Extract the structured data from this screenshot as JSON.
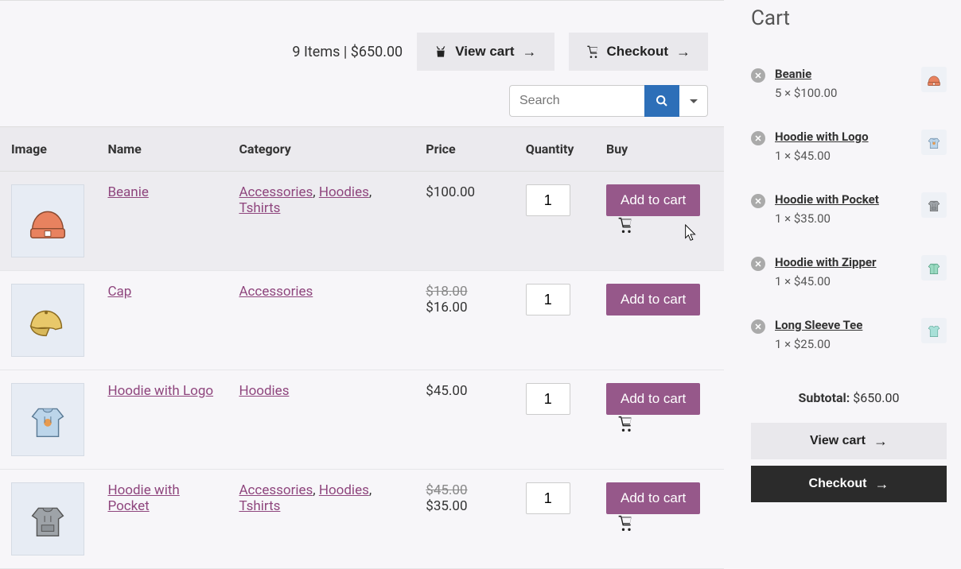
{
  "toolbar": {
    "summary": "9 Items | $650.00",
    "view_cart": "View cart",
    "checkout": "Checkout"
  },
  "search": {
    "placeholder": "Search"
  },
  "columns": {
    "image": "Image",
    "name": "Name",
    "category": "Category",
    "price": "Price",
    "quantity": "Quantity",
    "buy": "Buy"
  },
  "add_to_cart_label": "Add to cart",
  "products": [
    {
      "name": "Beanie",
      "categories": [
        "Accessories",
        "Hoodies",
        "Tshirts"
      ],
      "price": "$100.00",
      "old_price": "",
      "qty": "1",
      "in_cart": true,
      "highlight": true,
      "icon": "beanie"
    },
    {
      "name": "Cap",
      "categories": [
        "Accessories"
      ],
      "price": "$16.00",
      "old_price": "$18.00",
      "qty": "1",
      "in_cart": false,
      "highlight": false,
      "icon": "cap"
    },
    {
      "name": "Hoodie with Logo",
      "categories": [
        "Hoodies"
      ],
      "price": "$45.00",
      "old_price": "",
      "qty": "1",
      "in_cart": true,
      "highlight": false,
      "icon": "hoodie-blue"
    },
    {
      "name": "Hoodie with Pocket",
      "categories": [
        "Accessories",
        "Hoodies",
        "Tshirts"
      ],
      "price": "$35.00",
      "old_price": "$45.00",
      "qty": "1",
      "in_cart": true,
      "highlight": false,
      "icon": "hoodie-grey"
    }
  ],
  "cart": {
    "title": "Cart",
    "items": [
      {
        "name": "Beanie",
        "meta": "5 × $100.00",
        "icon": "beanie"
      },
      {
        "name": "Hoodie with Logo",
        "meta": "1 × $45.00",
        "icon": "hoodie-blue"
      },
      {
        "name": "Hoodie with Pocket",
        "meta": "1 × $35.00",
        "icon": "hoodie-grey"
      },
      {
        "name": "Hoodie with Zipper",
        "meta": "1 × $45.00",
        "icon": "hoodie-green"
      },
      {
        "name": "Long Sleeve Tee",
        "meta": "1 × $25.00",
        "icon": "tee"
      }
    ],
    "subtotal_label": "Subtotal:",
    "subtotal": "$650.00",
    "view_cart": "View cart",
    "checkout": "Checkout"
  }
}
